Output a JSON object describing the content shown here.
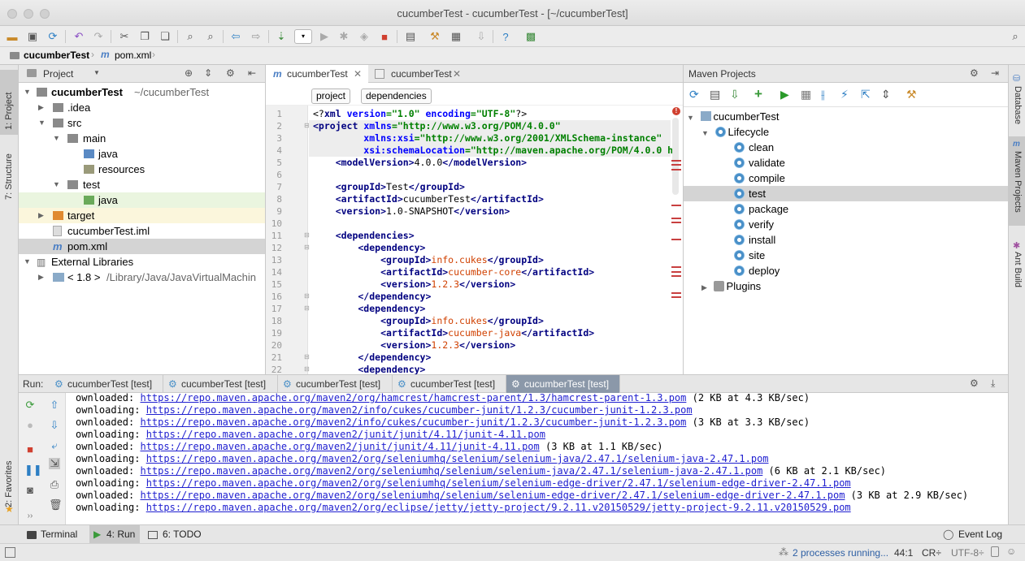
{
  "window": {
    "title": "cucumberTest - cucumberTest - [~/cucumberTest]"
  },
  "navbar": {
    "items": [
      "cucumberTest",
      "pom.xml"
    ]
  },
  "left_strip": {
    "tabs": [
      "1: Project",
      "7: Structure",
      "2: Favorites"
    ]
  },
  "right_strip": {
    "tabs": [
      "Database",
      "Maven Projects",
      "Ant Build"
    ]
  },
  "project": {
    "header": "Project",
    "tree": [
      {
        "label": "cucumberTest",
        "hint": "~/cucumberTest",
        "bold": true
      },
      {
        "label": ".idea"
      },
      {
        "label": "src"
      },
      {
        "label": "main"
      },
      {
        "label": "java"
      },
      {
        "label": "resources"
      },
      {
        "label": "test"
      },
      {
        "label": "java"
      },
      {
        "label": "target"
      },
      {
        "label": "cucumberTest.iml"
      },
      {
        "label": "pom.xml"
      },
      {
        "label": "External Libraries"
      },
      {
        "label": "< 1.8 >",
        "hint": "/Library/Java/JavaVirtualMachin"
      }
    ]
  },
  "editor": {
    "tabs": [
      {
        "label": "cucumberTest",
        "active": true
      },
      {
        "label": "cucumberTest",
        "active": false
      }
    ],
    "breadcrumbs": [
      "project",
      "dependencies"
    ],
    "line_numbers": [
      "1",
      "2",
      "3",
      "4",
      "5",
      "6",
      "7",
      "8",
      "9",
      "10",
      "11",
      "12",
      "13",
      "14",
      "15",
      "16",
      "17",
      "18",
      "19",
      "20",
      "21",
      "22"
    ],
    "code": {
      "l1_a": "<?",
      "l1_b": "xml ",
      "l1_c": "version",
      "l1_d": "=\"1.0\" ",
      "l1_e": "encoding",
      "l1_f": "=\"UTF-8\"",
      "l1_g": "?>",
      "l2_a": "<project ",
      "l2_b": "xmlns",
      "l2_c": "=\"http://www.w3.org/POM/4.0.0\"",
      "l3_a": "         xmlns:xsi",
      "l3_b": "=\"http://www.w3.org/2001/XMLSchema-instance\"",
      "l4_a": "         xsi:schemaLocation",
      "l4_b": "=\"http://maven.apache.org/POM/4.0.0 ht",
      "l5_a": "    <modelVersion>",
      "l5_b": "4.0.0",
      "l5_c": "</modelVersion>",
      "l7_a": "    <groupId>",
      "l7_b": "Test",
      "l7_c": "</groupId>",
      "l8_a": "    <artifactId>",
      "l8_b": "cucumberTest",
      "l8_c": "</artifactId>",
      "l9_a": "    <version>",
      "l9_b": "1.0-SNAPSHOT",
      "l9_c": "</version>",
      "l11": "    <dependencies>",
      "l12": "        <dependency>",
      "l13_a": "            <groupId>",
      "l13_b": "info.cukes",
      "l13_c": "</groupId>",
      "l14_a": "            <artifactId>",
      "l14_b": "cucumber-core",
      "l14_c": "</artifactId>",
      "l15_a": "            <version>",
      "l15_b": "1.2.3",
      "l15_c": "</version>",
      "l16": "        </dependency>",
      "l17": "        <dependency>",
      "l18_a": "            <groupId>",
      "l18_b": "info.cukes",
      "l18_c": "</groupId>",
      "l19_a": "            <artifactId>",
      "l19_b": "cucumber-java",
      "l19_c": "</artifactId>",
      "l20_a": "            <version>",
      "l20_b": "1.2.3",
      "l20_c": "</version>",
      "l21": "        </dependency>",
      "l22": "        <dependency>"
    }
  },
  "maven": {
    "header": "Maven Projects",
    "root": "cucumberTest",
    "lifecycle": "Lifecycle",
    "phases": [
      "clean",
      "validate",
      "compile",
      "test",
      "package",
      "verify",
      "install",
      "site",
      "deploy"
    ],
    "selected": "test",
    "plugins": "Plugins"
  },
  "run": {
    "label": "Run:",
    "tabs": [
      "cucumberTest [test]",
      "cucumberTest [test]",
      "cucumberTest [test]",
      "cucumberTest [test]",
      "cucumberTest [test]"
    ],
    "log": [
      {
        "prefix": "ownloaded: ",
        "url": "https://repo.maven.apache.org/maven2/org/hamcrest/hamcrest-parent/1.3/hamcrest-parent-1.3.pom",
        "suffix": " (2 KB at 4.3 KB/sec)"
      },
      {
        "prefix": "ownloading: ",
        "url": "https://repo.maven.apache.org/maven2/info/cukes/cucumber-junit/1.2.3/cucumber-junit-1.2.3.pom",
        "suffix": ""
      },
      {
        "prefix": "ownloaded: ",
        "url": "https://repo.maven.apache.org/maven2/info/cukes/cucumber-junit/1.2.3/cucumber-junit-1.2.3.pom",
        "suffix": " (3 KB at 3.3 KB/sec)"
      },
      {
        "prefix": "ownloading: ",
        "url": "https://repo.maven.apache.org/maven2/junit/junit/4.11/junit-4.11.pom",
        "suffix": ""
      },
      {
        "prefix": "ownloaded: ",
        "url": "https://repo.maven.apache.org/maven2/junit/junit/4.11/junit-4.11.pom",
        "suffix": " (3 KB at 1.1 KB/sec)"
      },
      {
        "prefix": "ownloading: ",
        "url": "https://repo.maven.apache.org/maven2/org/seleniumhq/selenium/selenium-java/2.47.1/selenium-java-2.47.1.pom",
        "suffix": ""
      },
      {
        "prefix": "ownloaded: ",
        "url": "https://repo.maven.apache.org/maven2/org/seleniumhq/selenium/selenium-java/2.47.1/selenium-java-2.47.1.pom",
        "suffix": " (6 KB at 2.1 KB/sec)"
      },
      {
        "prefix": "ownloading: ",
        "url": "https://repo.maven.apache.org/maven2/org/seleniumhq/selenium/selenium-edge-driver/2.47.1/selenium-edge-driver-2.47.1.pom",
        "suffix": ""
      },
      {
        "prefix": "ownloaded: ",
        "url": "https://repo.maven.apache.org/maven2/org/seleniumhq/selenium/selenium-edge-driver/2.47.1/selenium-edge-driver-2.47.1.pom",
        "suffix": " (3 KB at 2.9 KB/sec)"
      },
      {
        "prefix": "ownloading: ",
        "url": "https://repo.maven.apache.org/maven2/org/eclipse/jetty/jetty-project/9.2.11.v20150529/jetty-project-9.2.11.v20150529.pom",
        "suffix": ""
      }
    ]
  },
  "bottom_tabs": {
    "terminal": "Terminal",
    "run": "4: Run",
    "todo": "6: TODO",
    "event_log": "Event Log"
  },
  "status": {
    "processes": "2 processes running...",
    "position": "44:1",
    "line_sep": "CR÷",
    "encoding": "UTF-8÷"
  },
  "colors": {
    "selection": "#d4d4d4",
    "active_run_tab": "#8b98a9",
    "test_folder": "#eaf5df",
    "link": "#2020d0"
  }
}
